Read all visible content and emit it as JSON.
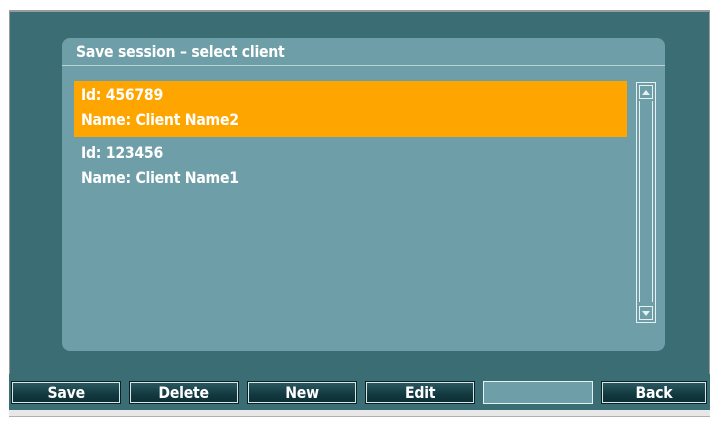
{
  "dialog": {
    "title": "Save session – select client"
  },
  "clients": [
    {
      "id_line": "Id: 456789",
      "name_line": "Name: Client Name2",
      "selected": true
    },
    {
      "id_line": "Id: 123456",
      "name_line": "Name: Client Name1",
      "selected": false
    }
  ],
  "toolbar": {
    "save_label": "Save",
    "delete_label": "Delete",
    "new_label": "New",
    "edit_label": "Edit",
    "empty_label": "",
    "back_label": "Back"
  },
  "colors": {
    "screen_bg": "#3b6e74",
    "dialog_bg": "#6e9fa8",
    "selection": "#ffa500",
    "button_bg": "#12393f",
    "text": "#ffffff"
  },
  "icons": {
    "scroll_up": "triangle-up-icon",
    "scroll_down": "triangle-down-icon"
  }
}
